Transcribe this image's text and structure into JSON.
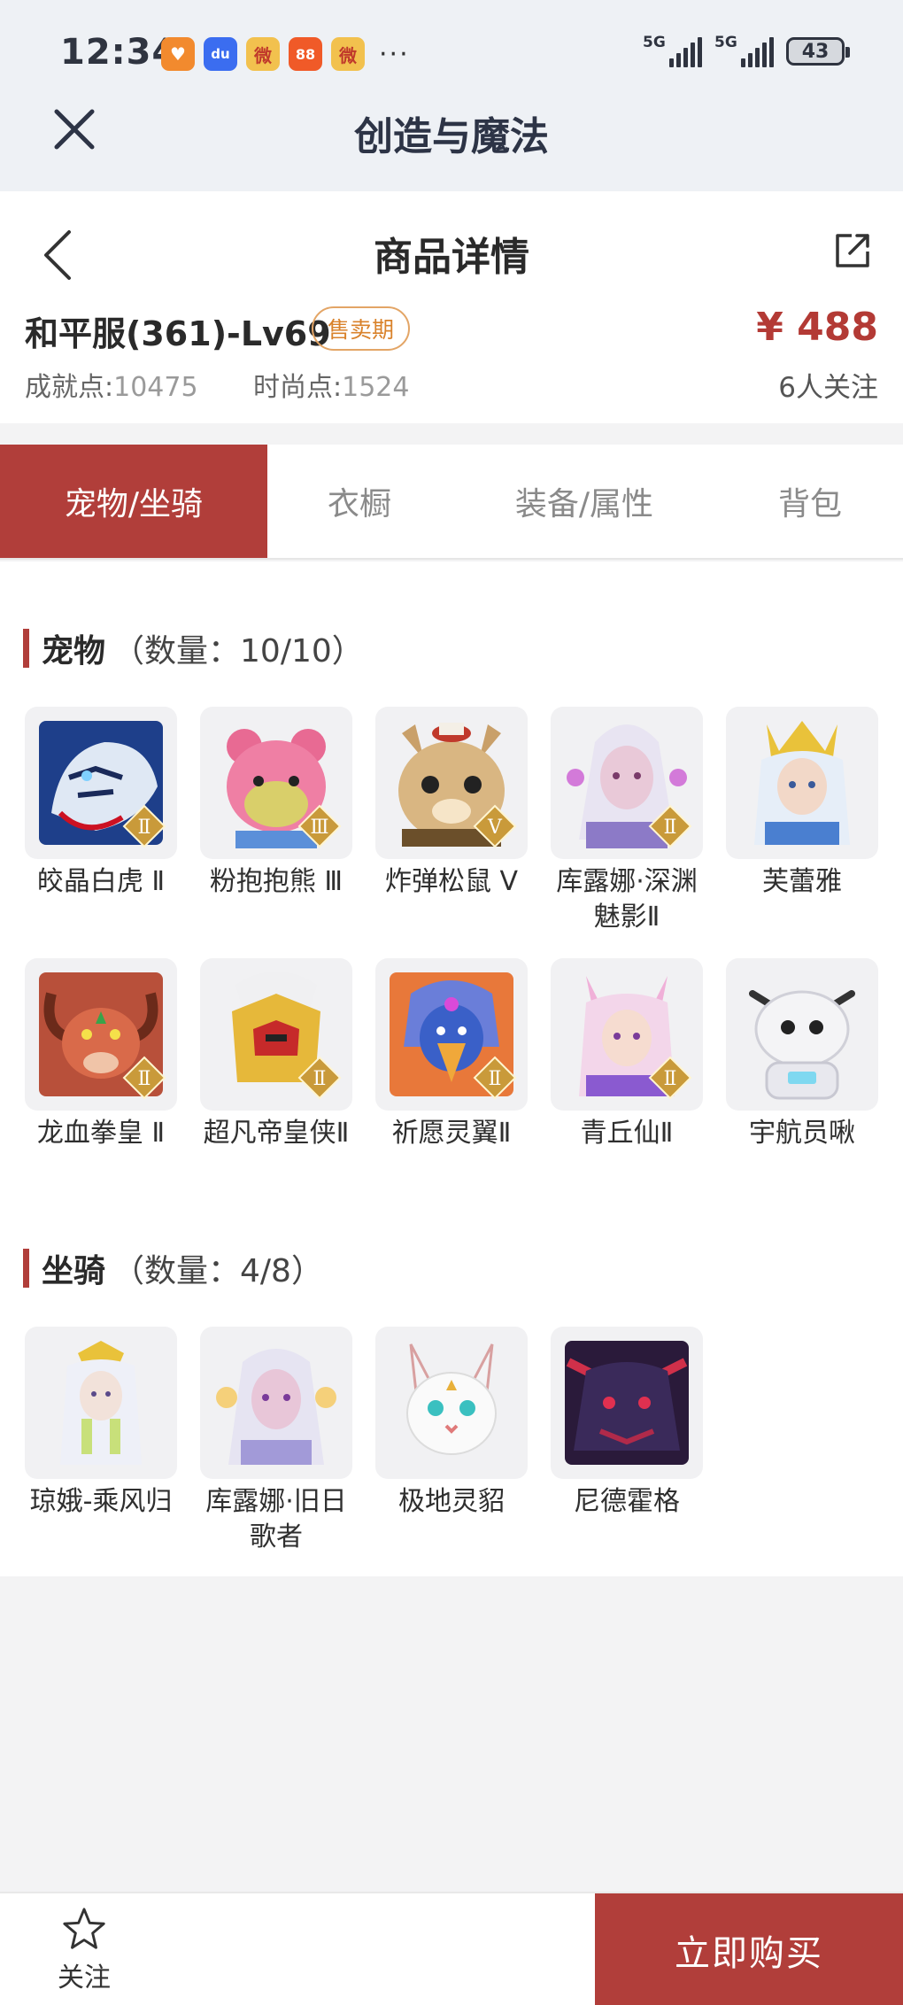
{
  "status_bar": {
    "time": "12:34",
    "apps": [
      {
        "icon": "heart-shield-app-icon",
        "color": "#f28a2e",
        "glyph": "♥"
      },
      {
        "icon": "paw-app-icon",
        "color": "#3b6df0",
        "glyph": "du"
      },
      {
        "icon": "weibo-app-icon",
        "color": "#f2c14e",
        "glyph": "微"
      },
      {
        "icon": "grid-app-icon",
        "color": "#f05a28",
        "glyph": "88"
      },
      {
        "icon": "weibo-app-icon",
        "color": "#f2c14e",
        "glyph": "微"
      }
    ],
    "more": "···",
    "signal1_label": "5G",
    "signal2_label": "5G",
    "battery": "43"
  },
  "app_header": {
    "title": "创造与魔法"
  },
  "product": {
    "page_title": "商品详情",
    "name": "和平服(361)-Lv69",
    "badge": "售卖期",
    "price": "¥ 488",
    "stat1_label": "成就点:",
    "stat1_value": "10475",
    "stat2_label": "时尚点:",
    "stat2_value": "1524",
    "followers": "6人关注"
  },
  "tabs": [
    {
      "label": "宠物/坐骑",
      "active": true
    },
    {
      "label": "衣橱",
      "active": false
    },
    {
      "label": "装备/属性",
      "active": false
    },
    {
      "label": "背包",
      "active": false
    }
  ],
  "pets": {
    "title": "宠物",
    "count": "（数量：10/10）",
    "items": [
      {
        "name": "皎晶白虎 Ⅱ",
        "rank": "Ⅱ"
      },
      {
        "name": "粉抱抱熊 Ⅲ",
        "rank": "Ⅲ"
      },
      {
        "name": "炸弹松鼠 Ⅴ",
        "rank": "Ⅴ"
      },
      {
        "name": "库露娜·深渊魅影Ⅱ",
        "rank": "Ⅱ"
      },
      {
        "name": "芙蕾雅",
        "rank": ""
      },
      {
        "name": "龙血拳皇 Ⅱ",
        "rank": "Ⅱ"
      },
      {
        "name": "超凡帝皇侠Ⅱ",
        "rank": "Ⅱ"
      },
      {
        "name": "祈愿灵翼Ⅱ",
        "rank": "Ⅱ"
      },
      {
        "name": "青丘仙Ⅱ",
        "rank": "Ⅱ"
      },
      {
        "name": "宇航员啾",
        "rank": ""
      }
    ]
  },
  "mounts": {
    "title": "坐骑",
    "count": "（数量：4/8）",
    "items": [
      {
        "name": "琼娥-乘风归"
      },
      {
        "name": "库露娜·旧日歌者"
      },
      {
        "name": "极地灵貂"
      },
      {
        "name": "尼德霍格"
      }
    ]
  },
  "bottom": {
    "follow_label": "关注",
    "buy_label": "立即购买"
  },
  "colors": {
    "accent": "#b13e3a",
    "badge_orange": "#d9822b",
    "price_red": "#b33a35"
  }
}
